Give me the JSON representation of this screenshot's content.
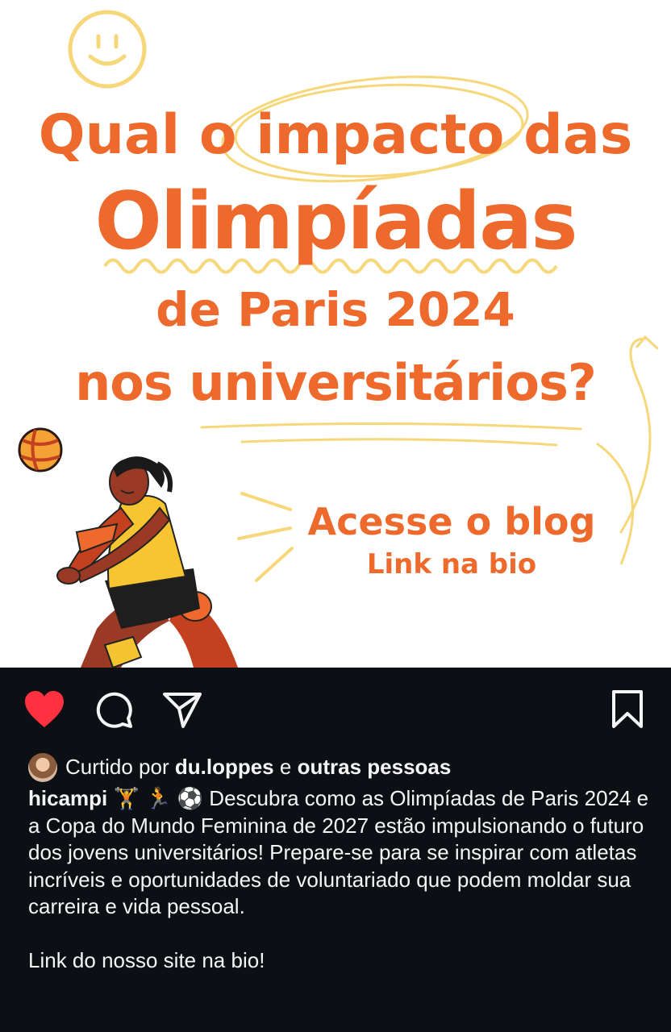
{
  "post": {
    "headline_line1": "Qual o impacto das",
    "headline_line2": "Olimpíadas",
    "headline_line3": "de Paris 2024",
    "headline_line4": "nos universitários?",
    "cta_title": "Acesse o blog",
    "cta_subtitle": "Link na bio"
  },
  "actions": {
    "like_icon": "heart-icon",
    "comment_icon": "comment-icon",
    "share_icon": "paper-plane-icon",
    "save_icon": "bookmark-icon",
    "liked": true
  },
  "likes": {
    "prefix": "Curtido por",
    "user": "du.loppes",
    "connector": "e",
    "others": "outras pessoas"
  },
  "caption": {
    "username": "hicampi",
    "emojis": "🏋️ 🏃 ⚽",
    "text": "Descubra como as Olimpíadas de Paris 2024 e a Copa do Mundo Feminina de 2027 estão impulsionando o futuro dos jovens universitários! Prepare-se para se inspirar com atletas incríveis e oportunidades de voluntariado que podem moldar sua carreira e vida pessoal.",
    "footer": "Link do nosso site na bio!"
  },
  "colors": {
    "accent_orange": "#ee6a2c",
    "like_red": "#ff3040",
    "background_dark": "#0c1014",
    "doodle_yellow": "#f6d77a"
  }
}
